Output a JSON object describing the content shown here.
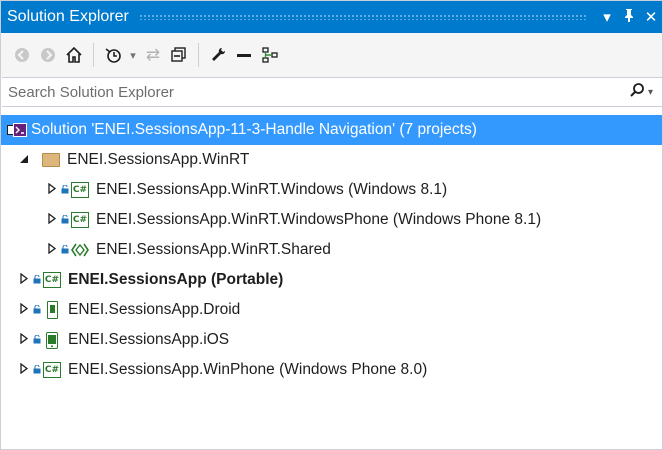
{
  "panel": {
    "title": "Solution Explorer",
    "dropdown_glyph": "▾",
    "pin_glyph": "Ꝑ",
    "close_glyph": "✕"
  },
  "toolbar": {
    "back_glyph": "◉",
    "forward_glyph": "◉",
    "home_glyph": "⌂",
    "history_glyph": "↺",
    "history_drop_glyph": "▾",
    "sync_glyph": "⇄",
    "collapse_glyph": "⧉",
    "properties_glyph": "🔧",
    "minus_glyph": "▬",
    "diagram_glyph": "⛶"
  },
  "search": {
    "placeholder": "Search Solution Explorer",
    "icon_glyph": "⚲",
    "drop_glyph": "▾"
  },
  "tree": {
    "solution": {
      "label": "Solution 'ENEI.SessionsApp-11-3-Handle Navigation' (7 projects)"
    },
    "items": [
      {
        "label": "ENEI.SessionsApp.WinRT",
        "expander": "◢",
        "icon": "folder-icon"
      },
      {
        "label": "ENEI.SessionsApp.WinRT.Windows (Windows 8.1)",
        "expander": "▷",
        "icon": "csharp-project-icon"
      },
      {
        "label": "ENEI.SessionsApp.WinRT.WindowsPhone (Windows Phone 8.1)",
        "expander": "▷",
        "icon": "csharp-project-icon"
      },
      {
        "label": "ENEI.SessionsApp.WinRT.Shared",
        "expander": "▷",
        "icon": "shared-project-icon"
      },
      {
        "label": "ENEI.SessionsApp (Portable)",
        "expander": "▷",
        "icon": "csharp-project-icon"
      },
      {
        "label": "ENEI.SessionsApp.Droid",
        "expander": "▷",
        "icon": "android-project-icon"
      },
      {
        "label": "ENEI.SessionsApp.iOS",
        "expander": "▷",
        "icon": "ios-project-icon"
      },
      {
        "label": "ENEI.SessionsApp.WinPhone (Windows Phone 8.0)",
        "expander": "▷",
        "icon": "csharp-project-icon"
      }
    ],
    "csharp_glyph": "C#",
    "shared_glyph": "◈",
    "lock_glyph": "🔒"
  },
  "colors": {
    "title_bar": "#007acc",
    "selection": "#3399ff",
    "project_green": "#2b7a2b"
  }
}
